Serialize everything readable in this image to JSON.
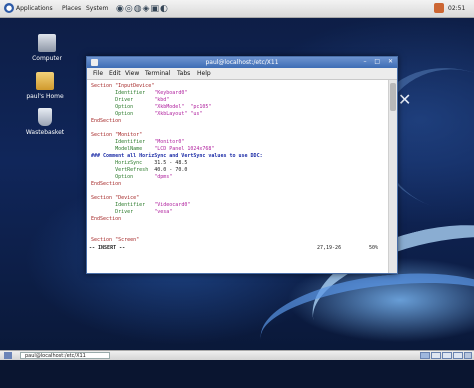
{
  "top_panel": {
    "applications": "Applications",
    "places": "Places",
    "system": "System",
    "clock": "02:51"
  },
  "desktop_icons": [
    {
      "label": "Computer"
    },
    {
      "label": "paul's Home"
    },
    {
      "label": "Wastebasket"
    }
  ],
  "window": {
    "title": "paul@localhost:/etc/X11",
    "menu": [
      "File",
      "Edit",
      "View",
      "Terminal",
      "Tabs",
      "Help"
    ]
  },
  "terminal": {
    "lines": {
      "l1": "Section \"InputDevice\"",
      "l2_key": "Identifier",
      "l2_val": "\"Keyboard0\"",
      "l3_key": "Driver",
      "l3_val": "\"kbd\"",
      "l4_key": "Option",
      "l4_a": "\"XkbModel\"",
      "l4_b": "\"pc105\"",
      "l5_key": "Option",
      "l5_a": "\"XkbLayout\"",
      "l5_b": "\"us\"",
      "l6": "EndSection",
      "l7": "Section \"Monitor\"",
      "l8_key": "Identifier",
      "l8_val": "\"Monitor0\"",
      "l9_key": "ModelName",
      "l9_val": "\"LCD Panel 1024x768\"",
      "l10": "### Comment all HorizSync and VertSync values to use DDC:",
      "l11_key": "HorizSync",
      "l11_val": "31.5 - 48.5",
      "l12_key": "VertRefresh",
      "l12_val": "40.0 - 70.0",
      "l13_key": "Option",
      "l13_val": "\"dpms\"",
      "l14": "EndSection",
      "l15": "Section \"Device\"",
      "l16_key": "Identifier",
      "l16_val": "\"Videocard0\"",
      "l17_key": "Driver",
      "l17_val": "\"vesa\"",
      "l18": "EndSection",
      "l19": "Section \"Screen\""
    },
    "mode": "-- INSERT --",
    "position": "27,19-26",
    "percent": "50%"
  },
  "bottom_panel": {
    "task": "paul@localhost:/etc/X11"
  }
}
